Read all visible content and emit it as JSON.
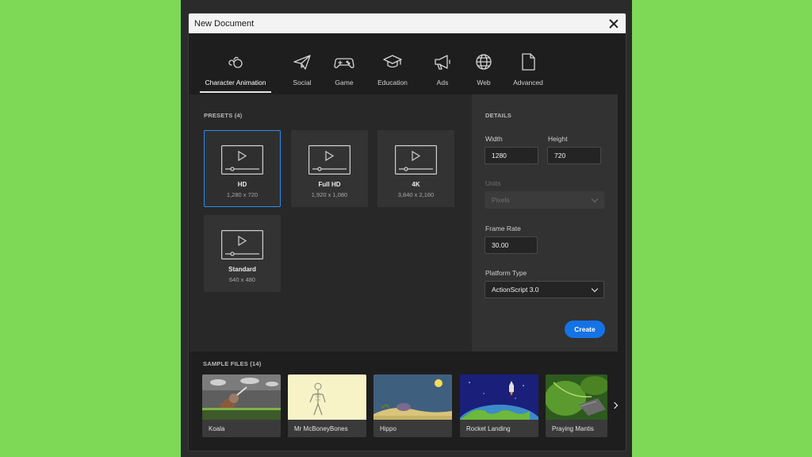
{
  "dialog": {
    "title": "New Document"
  },
  "tabs": [
    {
      "label": "Character Animation",
      "icon": "character-animation-icon"
    },
    {
      "label": "Social",
      "icon": "paper-plane-icon"
    },
    {
      "label": "Game",
      "icon": "gamepad-icon"
    },
    {
      "label": "Education",
      "icon": "graduation-cap-icon"
    },
    {
      "label": "Ads",
      "icon": "megaphone-icon"
    },
    {
      "label": "Web",
      "icon": "globe-icon"
    },
    {
      "label": "Advanced",
      "icon": "document-icon"
    }
  ],
  "presets": {
    "label": "PRESETS (4)",
    "items": [
      {
        "name": "HD",
        "size": "1,280 x 720"
      },
      {
        "name": "Full HD",
        "size": "1,920 x 1,080"
      },
      {
        "name": "4K",
        "size": "3,840 x 2,160"
      },
      {
        "name": "Standard",
        "size": "640 x 480"
      }
    ]
  },
  "details": {
    "label": "DETAILS",
    "width_label": "Width",
    "width_value": "1280",
    "height_label": "Height",
    "height_value": "720",
    "units_label": "Units",
    "units_value": "Pixels",
    "frame_rate_label": "Frame Rate",
    "frame_rate_value": "30.00",
    "platform_label": "Platform Type",
    "platform_value": "ActionScript 3.0",
    "create_label": "Create"
  },
  "samples": {
    "label": "SAMPLE FILES (14)",
    "items": [
      {
        "name": "Koala"
      },
      {
        "name": "Mr McBoneyBones"
      },
      {
        "name": "Hippo"
      },
      {
        "name": "Rocket Landing"
      },
      {
        "name": "Praying Mantis"
      }
    ]
  },
  "colors": {
    "background": "#7ed957",
    "accent": "#1473e6",
    "selected_border": "#2d8ceb"
  }
}
